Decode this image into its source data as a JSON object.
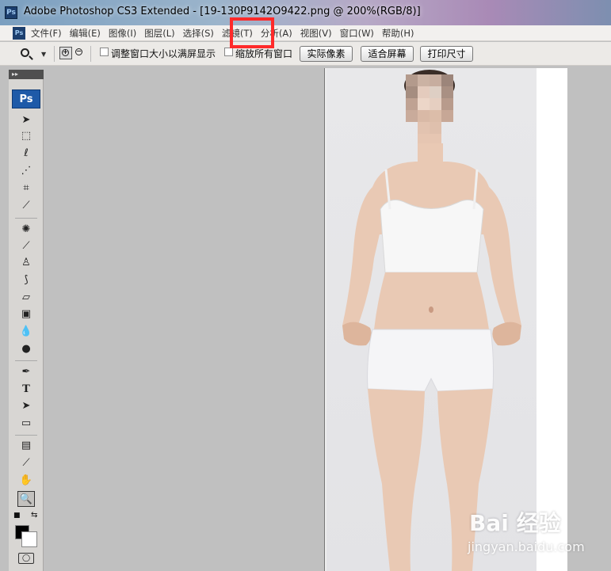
{
  "window": {
    "title": "Adobe Photoshop CS3 Extended - [19-130P9142O9422.png @ 200%(RGB/8)]",
    "app_icon": "Ps"
  },
  "menubar": {
    "doc_icon": "Ps",
    "items": [
      {
        "label": "文件(F)"
      },
      {
        "label": "编辑(E)"
      },
      {
        "label": "图像(I)"
      },
      {
        "label": "图层(L)"
      },
      {
        "label": "选择(S)"
      },
      {
        "label": "滤镜(T)"
      },
      {
        "label": "分析(A)"
      },
      {
        "label": "视图(V)"
      },
      {
        "label": "窗口(W)"
      },
      {
        "label": "帮助(H)"
      }
    ],
    "highlight_color": "#ff2a2a"
  },
  "optionsbar": {
    "tool_icon": "zoom-tool-icon",
    "zoom_in_icon": "zoom-in-icon",
    "zoom_out_icon": "zoom-out-icon",
    "resize_windows_label": "调整窗口大小以满屏显示",
    "zoom_all_windows_label": "缩放所有窗口",
    "actual_pixels_label": "实际像素",
    "fit_screen_label": "适合屏幕",
    "print_size_label": "打印尺寸"
  },
  "toolbox": {
    "grip": "▸▸",
    "badge": "Ps",
    "foreground_color": "#000000",
    "background_color": "#ffffff"
  },
  "watermark": {
    "main": "Bai 经验",
    "sub": "jingyan.baidu.com"
  }
}
